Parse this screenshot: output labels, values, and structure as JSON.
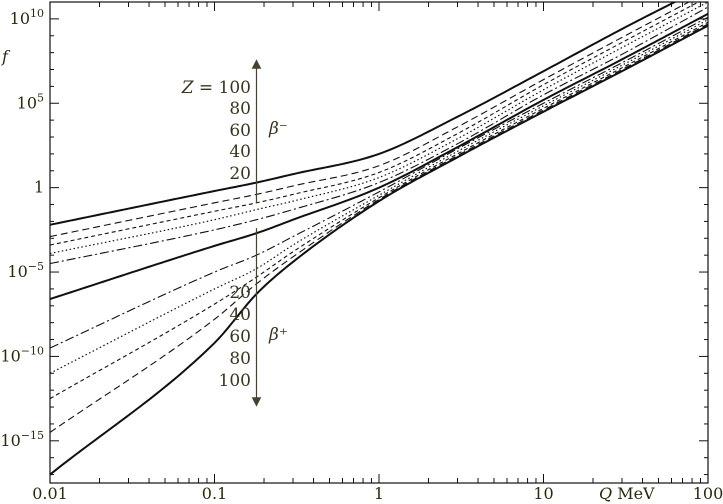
{
  "chart_data": {
    "type": "line",
    "title": "",
    "ylabel": "f",
    "xlabel_var": "Q",
    "xlabel_unit": "MeV",
    "xscale": "log",
    "yscale": "log",
    "xlim": [
      0.01,
      100
    ],
    "ylim_exp": [
      -17.5,
      11
    ],
    "x_ticks": [
      {
        "value": 0.01,
        "label": "0.01"
      },
      {
        "value": 0.1,
        "label": "0.1"
      },
      {
        "value": 1,
        "label": "1"
      },
      {
        "value": 10,
        "label": "10"
      },
      {
        "value": 100,
        "label": "100"
      }
    ],
    "y_ticks": [
      {
        "exp": 10,
        "base": "10",
        "sup": "10"
      },
      {
        "exp": 5,
        "base": "10",
        "sup": "5"
      },
      {
        "exp": 0,
        "base": "1",
        "sup": ""
      },
      {
        "exp": -5,
        "base": "10",
        "sup": "−5"
      },
      {
        "exp": -10,
        "base": "10",
        "sup": "−10"
      },
      {
        "exp": -15,
        "base": "10",
        "sup": "−15"
      }
    ],
    "x_points": [
      0.01,
      0.1,
      0.18,
      0.3,
      1,
      3,
      10,
      30,
      100
    ],
    "series": [
      {
        "group": "beta-minus",
        "z": 0,
        "style": "solid-bold",
        "log10_f": [
          -6.6,
          -3.45,
          -2.7,
          -1.9,
          0.0,
          2.4,
          5.2,
          7.6,
          10.3
        ]
      },
      {
        "group": "beta-minus",
        "z": 20,
        "style": "dashdot",
        "log10_f": [
          -4.5,
          -2.5,
          -1.9,
          -1.3,
          0.3,
          2.6,
          5.5,
          7.9,
          10.7
        ]
      },
      {
        "group": "beta-minus",
        "z": 40,
        "style": "dotted",
        "log10_f": [
          -3.9,
          -1.9,
          -1.3,
          -0.8,
          0.6,
          2.9,
          5.8,
          8.3,
          11.0
        ]
      },
      {
        "group": "beta-minus",
        "z": 60,
        "style": "dashed-short",
        "log10_f": [
          -3.4,
          -1.4,
          -0.9,
          -0.4,
          0.9,
          3.2,
          6.1,
          8.6,
          11.3
        ]
      },
      {
        "group": "beta-minus",
        "z": 80,
        "style": "dashed-long",
        "log10_f": [
          -2.9,
          -0.9,
          -0.4,
          0.1,
          1.3,
          3.6,
          6.4,
          8.9,
          11.6
        ]
      },
      {
        "group": "beta-minus",
        "z": 100,
        "style": "solid-bold",
        "log10_f": [
          -2.2,
          -0.2,
          0.3,
          0.8,
          2.0,
          4.2,
          6.9,
          9.4,
          12.0
        ]
      },
      {
        "group": "beta-plus",
        "z": 20,
        "style": "dashdot",
        "log10_f": [
          -9.5,
          -5.0,
          -4.0,
          -2.9,
          -0.25,
          2.3,
          5.0,
          7.4,
          10.1
        ]
      },
      {
        "group": "beta-plus",
        "z": 40,
        "style": "dotted",
        "log10_f": [
          -11.0,
          -6.0,
          -4.8,
          -3.4,
          -0.45,
          2.15,
          4.85,
          7.25,
          9.95
        ]
      },
      {
        "group": "beta-plus",
        "z": 60,
        "style": "dashed-short",
        "log10_f": [
          -12.5,
          -6.9,
          -5.3,
          -3.8,
          -0.6,
          2.0,
          4.7,
          7.1,
          9.8
        ]
      },
      {
        "group": "beta-plus",
        "z": 80,
        "style": "dashed-long",
        "log10_f": [
          -14.5,
          -7.8,
          -5.7,
          -4.1,
          -0.7,
          1.9,
          4.6,
          7.0,
          9.7
        ]
      },
      {
        "group": "beta-plus",
        "z": 100,
        "style": "solid-bold",
        "log10_f": [
          -17.0,
          -9.2,
          -6.3,
          -4.4,
          -0.8,
          1.8,
          4.5,
          6.9,
          9.6
        ]
      }
    ],
    "annotations": {
      "beta_minus_label": "β⁻",
      "beta_plus_label": "β⁺",
      "z_prefix": "Z =",
      "upper_z_values": [
        "100",
        "80",
        "60",
        "40",
        "20"
      ],
      "lower_z_values": [
        "20",
        "40",
        "60",
        "80",
        "100"
      ]
    },
    "arrow_x": 0.18,
    "grid": false,
    "legend": "none"
  }
}
